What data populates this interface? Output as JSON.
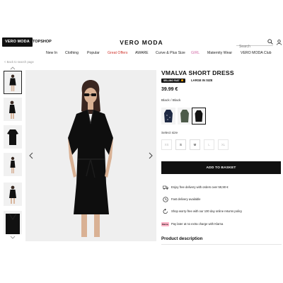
{
  "header": {
    "brand_primary": "VERO MODA",
    "brand_secondary": "TOPSHOP",
    "logo": "VERO MODA",
    "search_placeholder": "Search"
  },
  "nav": {
    "items": [
      {
        "label": "New In"
      },
      {
        "label": "Clothing"
      },
      {
        "label": "Popular"
      },
      {
        "label": "Great Offers",
        "color": "#d0342c"
      },
      {
        "label": "AWARE"
      },
      {
        "label": "Curve & Plus Size"
      },
      {
        "label": "GIRL",
        "color": "#d26aa6"
      },
      {
        "label": "Maternity Wear"
      },
      {
        "label": "VERO MODA Club"
      }
    ]
  },
  "breadcrumb": "< Back to search page",
  "product": {
    "title": "VMALVA SHORT DRESS",
    "badge": "SELLING FAST",
    "size_tag": "LARGE IN SIZE",
    "price": "39.99 €",
    "color_label": "Black / Black",
    "swatches": [
      {
        "name": "navy",
        "color": "#1f2a44"
      },
      {
        "name": "green",
        "color": "#4d5b4a"
      },
      {
        "name": "black",
        "color": "#111111",
        "selected": true
      }
    ],
    "size_label": "Select size",
    "sizes": [
      {
        "label": "XS",
        "available": false
      },
      {
        "label": "S",
        "available": true
      },
      {
        "label": "M",
        "available": true
      },
      {
        "label": "L",
        "available": false
      },
      {
        "label": "XL",
        "available": false
      }
    ],
    "basket_label": "ADD TO BASKET",
    "info": [
      {
        "icon": "delivery-truck-icon",
        "text": "Enjoy free delivery with orders over 59,90 €"
      },
      {
        "icon": "clock-icon",
        "text": "Fast delivery available"
      },
      {
        "icon": "return-arrow-icon",
        "text": "Shop worry-free with our 100 day online returns policy"
      },
      {
        "icon": "klarna-logo",
        "badge": "Klarna.",
        "text": "Pay later at no extra charge with Klarna"
      }
    ],
    "description_heading": "Product description"
  },
  "colors": {
    "accent": "#111111",
    "sale": "#d0342c",
    "girl": "#d26aa6",
    "badge_dot": "#f2a000",
    "klarna": "#ffb3c7"
  }
}
